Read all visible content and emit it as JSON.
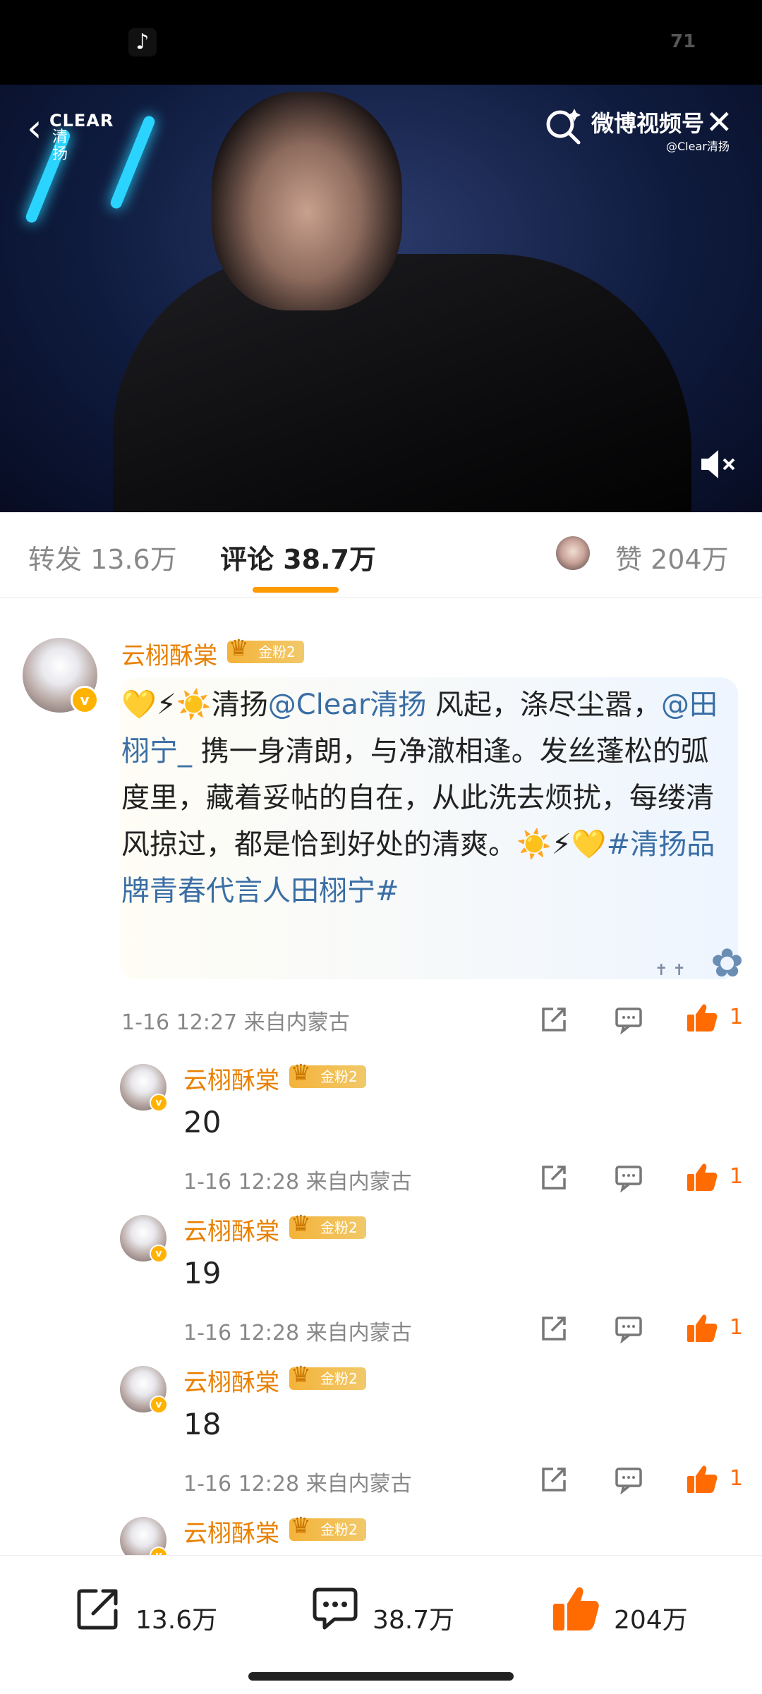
{
  "status_bar": {
    "app_icon": "tiktok-icon",
    "battery": "71"
  },
  "video": {
    "brand_logo_line1": "CLEAR",
    "brand_logo_line2": "清扬",
    "watermark": "微博视频号",
    "watermark_sub": "@Clear清扬",
    "icons": [
      "back-arrow-icon",
      "search-icon",
      "close-icon",
      "mute-icon"
    ]
  },
  "tabs": {
    "repost": "转发 13.6万",
    "comments": "评论 38.7万",
    "likes": "赞 204万"
  },
  "main_comment": {
    "user": "云栩酥棠",
    "fan_badge": "金粉2",
    "text": {
      "part1": "💛⚡☀️清扬",
      "mention1": "@Clear清扬",
      "part2": " 风起，涤尽尘嚣，",
      "mention2": "@田栩宁_",
      "part3": " 携一身清朗，与净澈相逢。发丝蓬松的弧度里，藏着妥帖的自在，从此洗去烦扰，每缕清风掠过，都是恰到好处的清爽。☀️⚡💛",
      "hashtag": "#清扬品牌青春代言人田栩宁#"
    },
    "meta": "1-16 12:27  来自内蒙古",
    "likes": "1"
  },
  "replies": [
    {
      "user": "云栩酥棠",
      "fan_badge": "金粉2",
      "text": "20",
      "meta": "1-16 12:28  来自内蒙古",
      "likes": "1"
    },
    {
      "user": "云栩酥棠",
      "fan_badge": "金粉2",
      "text": "19",
      "meta": "1-16 12:28  来自内蒙古",
      "likes": "1"
    },
    {
      "user": "云栩酥棠",
      "fan_badge": "金粉2",
      "text": "18",
      "meta": "1-16 12:28  来自内蒙古",
      "likes": "1"
    },
    {
      "user": "云栩酥棠",
      "fan_badge": "金粉2"
    }
  ],
  "bottom_bar": {
    "repost": "13.6万",
    "comments": "38.7万",
    "likes": "204万"
  },
  "colors": {
    "accent_orange": "#ff9a00",
    "username": "#e98000",
    "link_blue": "#3a6ea5",
    "like_orange": "#ff6b00"
  }
}
